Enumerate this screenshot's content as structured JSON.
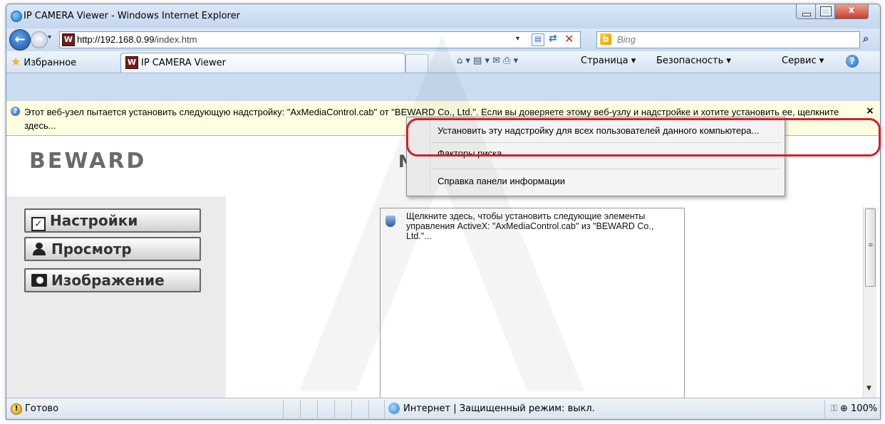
{
  "window": {
    "title": "IP CAMERA Viewer - Windows Internet Explorer",
    "close_symbol": "x",
    "accent_color": "#c7402b"
  },
  "nav": {
    "back_icon": "back-arrow-icon",
    "back_symbol": "←",
    "forward_symbol": "→",
    "dropdown_symbol": "▾",
    "url_host": "http://192.168.0.99",
    "url_path": "/index.htm",
    "address_dropdown": "▾",
    "stop_symbol": "✕",
    "refresh_symbol": "⇄",
    "search_placeholder": "Bing",
    "search_symbol": "⌕"
  },
  "command_bar": {
    "favorites_label": "Избранное",
    "tab_title": "IP CAMERA Viewer",
    "page_menu": "Страница ▾",
    "safety_menu": "Безопасность ▾",
    "tools_menu": "Сервис ▾",
    "help_symbol": "?",
    "icons_row": "⌂ ▾   ▤ ▾  ✉   ⎙ ▾"
  },
  "infobar": {
    "message": "Этот веб-узел пытается установить следующую надстройку: \"AxMediaControl.cab\" от \"BEWARD Co., Ltd.\". Если вы доверяете этому веб-узлу и надстройке и хотите установить ее, щелкните здесь...",
    "close_symbol": "×"
  },
  "context_menu": {
    "items": [
      "Установить эту надстройку для всех пользователей данного компьютера...",
      "Факторы риска",
      "Справка панели информации"
    ]
  },
  "page": {
    "logo": "BEWARD",
    "heading_fragment": "N",
    "nav_buttons": [
      "Настройки",
      "Просмотр",
      "Изображение"
    ],
    "activex_message": "Щелкните здесь, чтобы установить следующие элементы управления ActiveX: \"AxMediaControl.cab\" из \"BEWARD Co., Ltd.\"...",
    "scroll_grip": "≡",
    "scroll_down": "▼"
  },
  "status_bar": {
    "status": "Готово",
    "zone": "Интернет | Защищенный режим: выкл.",
    "zoom": "⊕ 100%",
    "zoom_dropdown": "▾"
  }
}
